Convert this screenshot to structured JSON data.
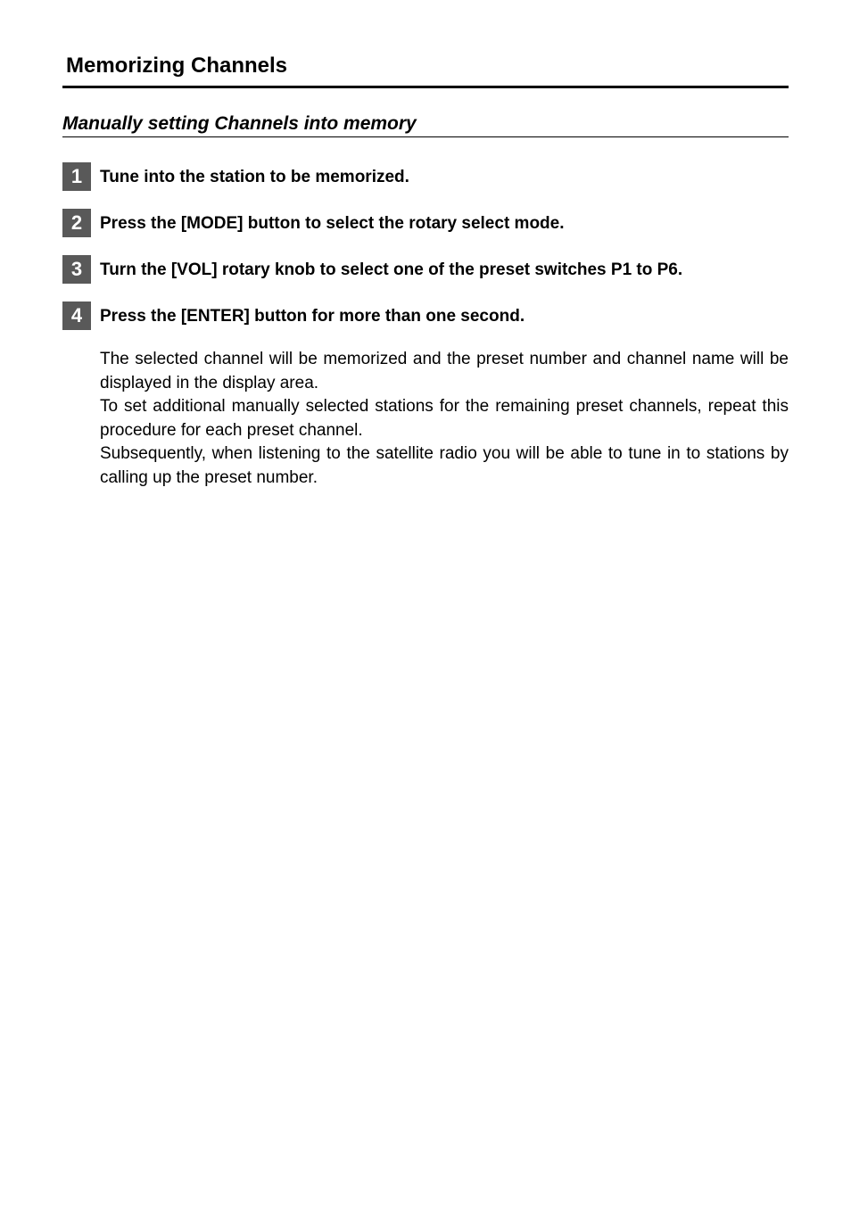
{
  "section": {
    "title": "Memorizing Channels",
    "subsection_title": "Manually setting Channels into memory"
  },
  "steps": [
    {
      "number": "1",
      "text": "Tune into the station to be memorized."
    },
    {
      "number": "2",
      "text": "Press the [MODE] button to select the rotary select mode."
    },
    {
      "number": "3",
      "text": "Turn the [VOL] rotary knob to select one of the preset switches P1 to P6."
    },
    {
      "number": "4",
      "text": "Press the [ENTER] button for more than one second."
    }
  ],
  "description": {
    "para1": "The selected channel will be memorized and the preset number and channel name will be displayed in the display area.",
    "para2": "To set additional manually selected stations for the remaining preset channels, repeat this procedure for each preset channel.",
    "para3": "Subsequently, when listening to the satellite radio you will be able to tune in to stations by calling up the preset number."
  }
}
